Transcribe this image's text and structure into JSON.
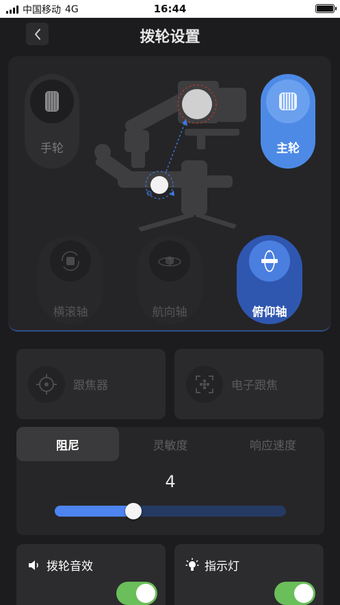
{
  "status_bar": {
    "carrier": "中国移动",
    "network": "4G",
    "time": "16:44"
  },
  "header": {
    "title": "拨轮设置"
  },
  "wheels": {
    "hand_label": "手轮",
    "main_label": "主轮",
    "selected": "主轮"
  },
  "axes": {
    "roll_label": "横滚轴",
    "pan_label": "航向轴",
    "tilt_label": "俯仰轴",
    "selected": "俯仰轴"
  },
  "focus": {
    "follow_focus_label": "跟焦器",
    "electronic_focus_label": "电子跟焦"
  },
  "params": {
    "tabs": [
      "阻尼",
      "灵敏度",
      "响应速度"
    ],
    "active_tab": "阻尼",
    "value": "4",
    "slider_fraction": 0.34
  },
  "settings": {
    "wheel_sound_label": "拨轮音效",
    "wheel_sound_on": true,
    "indicator_label": "指示灯",
    "indicator_on": true
  },
  "colors": {
    "accent": "#4d8ae6",
    "toggle_on": "#6abf5a",
    "background": "#1c1c1e"
  }
}
